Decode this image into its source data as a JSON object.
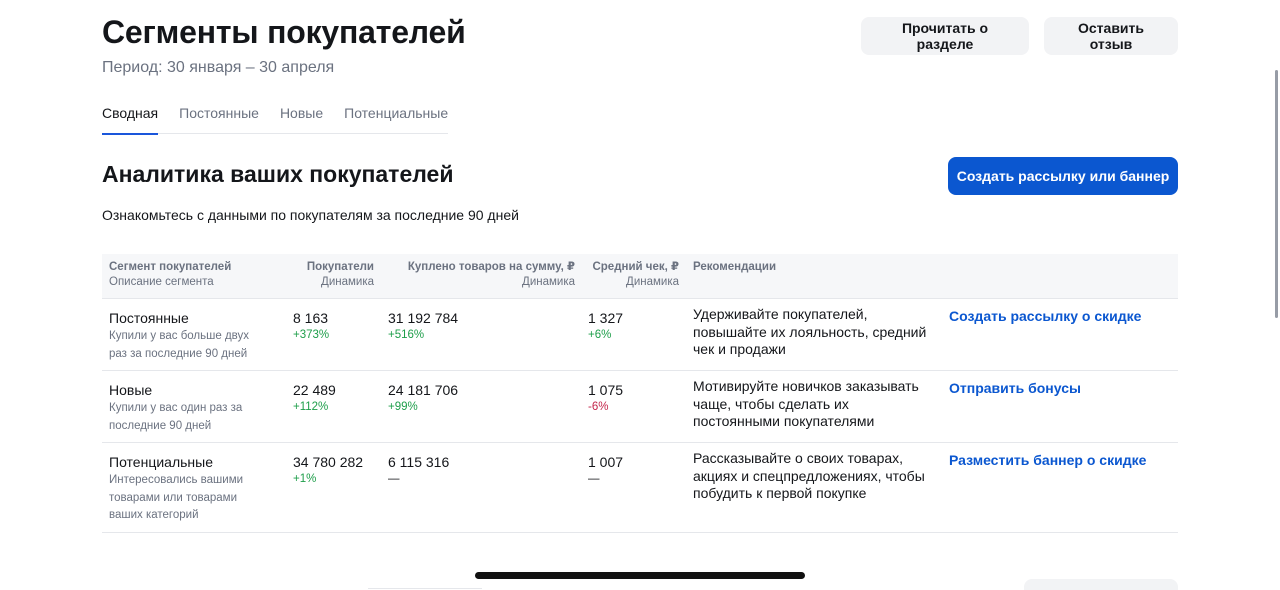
{
  "header": {
    "title": "Сегменты покупателей",
    "period": "Период: 30 января – 30 апреля",
    "read_button": "Прочитать о разделе",
    "feedback_button": "Оставить отзыв"
  },
  "tabs": [
    {
      "label": "Сводная",
      "active": true
    },
    {
      "label": "Постоянные",
      "active": false
    },
    {
      "label": "Новые",
      "active": false
    },
    {
      "label": "Потенциальные",
      "active": false
    }
  ],
  "section": {
    "title": "Аналитика ваших покупателей",
    "create_button": "Создать рассылку или баннер",
    "description": "Ознакомьтесь с данными по покупателям за последние 90 дней"
  },
  "table": {
    "headers": {
      "segment": "Сегмент покупателей",
      "segment_sub": "Описание сегмента",
      "buyers": "Покупатели",
      "buyers_sub": "Динамика",
      "purchased": "Куплено товаров на сумму, ₽",
      "purchased_sub": "Динамика",
      "avg_check": "Средний чек, ₽",
      "avg_check_sub": "Динамика",
      "recommendations": "Рекомендации"
    },
    "rows": [
      {
        "name": "Постоянные",
        "desc": "Купили у вас больше двух раз за последние 90 дней",
        "buyers": "8 163",
        "buyers_dyn": "+373%",
        "purchased": "31 192 784",
        "purchased_dyn": "+516%",
        "avg": "1 327",
        "avg_dyn": "+6%",
        "recommendation": "Удерживайте покупателей, повышайте их лояльность, средний чек и продажи",
        "action": "Создать рассылку о скидке"
      },
      {
        "name": "Новые",
        "desc": "Купили у вас один раз за последние 90 дней",
        "buyers": "22 489",
        "buyers_dyn": "+112%",
        "purchased": "24 181 706",
        "purchased_dyn": "+99%",
        "avg": "1 075",
        "avg_dyn": "-6%",
        "recommendation": "Мотивируйте новичков заказывать чаще, чтобы сделать их постоянными покупателями",
        "action": "Отправить бонусы"
      },
      {
        "name": "Потенциальные",
        "desc": "Интересовались вашими товарами или товарами ваших категорий",
        "buyers": "34 780 282",
        "buyers_dyn": "+1%",
        "purchased": "6 115 316",
        "purchased_dyn": "—",
        "avg": "1 007",
        "avg_dyn": "—",
        "recommendation": "Рассказывайте о своих товарах, акциях и спецпредложениях, чтобы побудить к первой покупке",
        "action": "Разместить баннер о скидке"
      }
    ]
  },
  "colors": {
    "accent": "#0b57d0",
    "positive": "#1e9e4a",
    "negative": "#c4264b"
  }
}
